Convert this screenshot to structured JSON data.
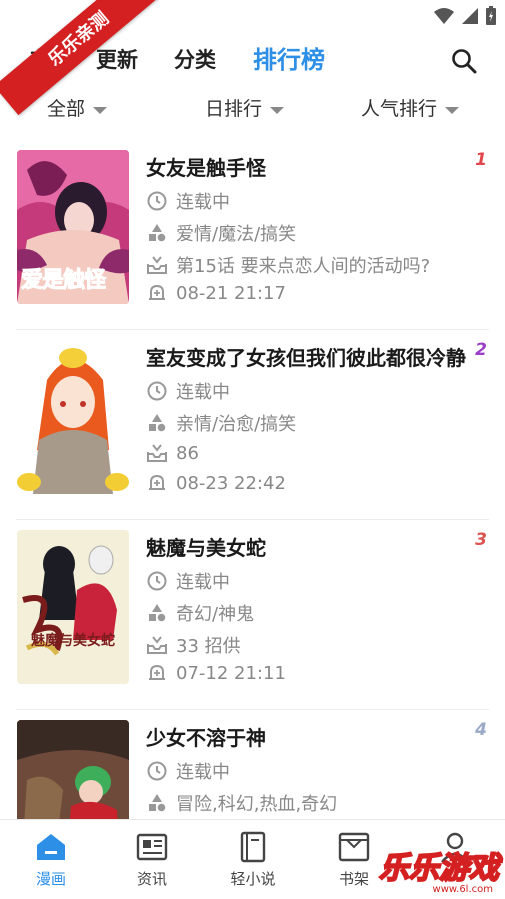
{
  "overlay": {
    "corner_banner": "乐乐亲测",
    "watermark": "乐乐游戏",
    "watermark_url": "www.6l.com"
  },
  "top_tabs": [
    {
      "label": "缓存",
      "visible_label": "存"
    },
    {
      "label": "更新"
    },
    {
      "label": "分类"
    },
    {
      "label": "排行榜",
      "active": true
    }
  ],
  "filters": [
    {
      "label": "全部"
    },
    {
      "label": "日排行"
    },
    {
      "label": "人气排行"
    }
  ],
  "items": [
    {
      "title": "女友是触手怪",
      "status": "连载中",
      "genres": "爱情/魔法/搞笑",
      "latest": "第15话 要来点恋人间的活动吗?",
      "updated": "08-21 21:17",
      "rank": "1",
      "cover_text": "爱是触怪"
    },
    {
      "title": "室友变成了女孩但我们彼此都很冷静",
      "status": "连载中",
      "genres": "亲情/治愈/搞笑",
      "latest": "86",
      "updated": "08-23 22:42",
      "rank": "2",
      "cover_text": ""
    },
    {
      "title": "魅魔与美女蛇",
      "status": "连载中",
      "genres": "奇幻/神鬼",
      "latest": "33 招供",
      "updated": "07-12 21:11",
      "rank": "3",
      "cover_text": "魅魔与美女蛇"
    },
    {
      "title": "少女不溶于神",
      "status": "连载中",
      "genres": "冒险,科幻,热血,奇幻",
      "latest": "",
      "updated": "",
      "rank": "4",
      "cover_text": ""
    }
  ],
  "bottom_nav": [
    {
      "label": "漫画",
      "icon": "home-icon",
      "active": true
    },
    {
      "label": "资讯",
      "icon": "news-icon"
    },
    {
      "label": "轻小说",
      "icon": "book-icon"
    },
    {
      "label": "书架",
      "icon": "bookshelf-icon"
    },
    {
      "label": "我的",
      "icon": "user-icon"
    }
  ],
  "colors": {
    "accent": "#2d8fe6",
    "banner": "#d42020",
    "rank1": "#e0474c",
    "rank2": "#9b3dc7",
    "rank3": "#d9534f",
    "rank4": "#9aa9c6"
  }
}
